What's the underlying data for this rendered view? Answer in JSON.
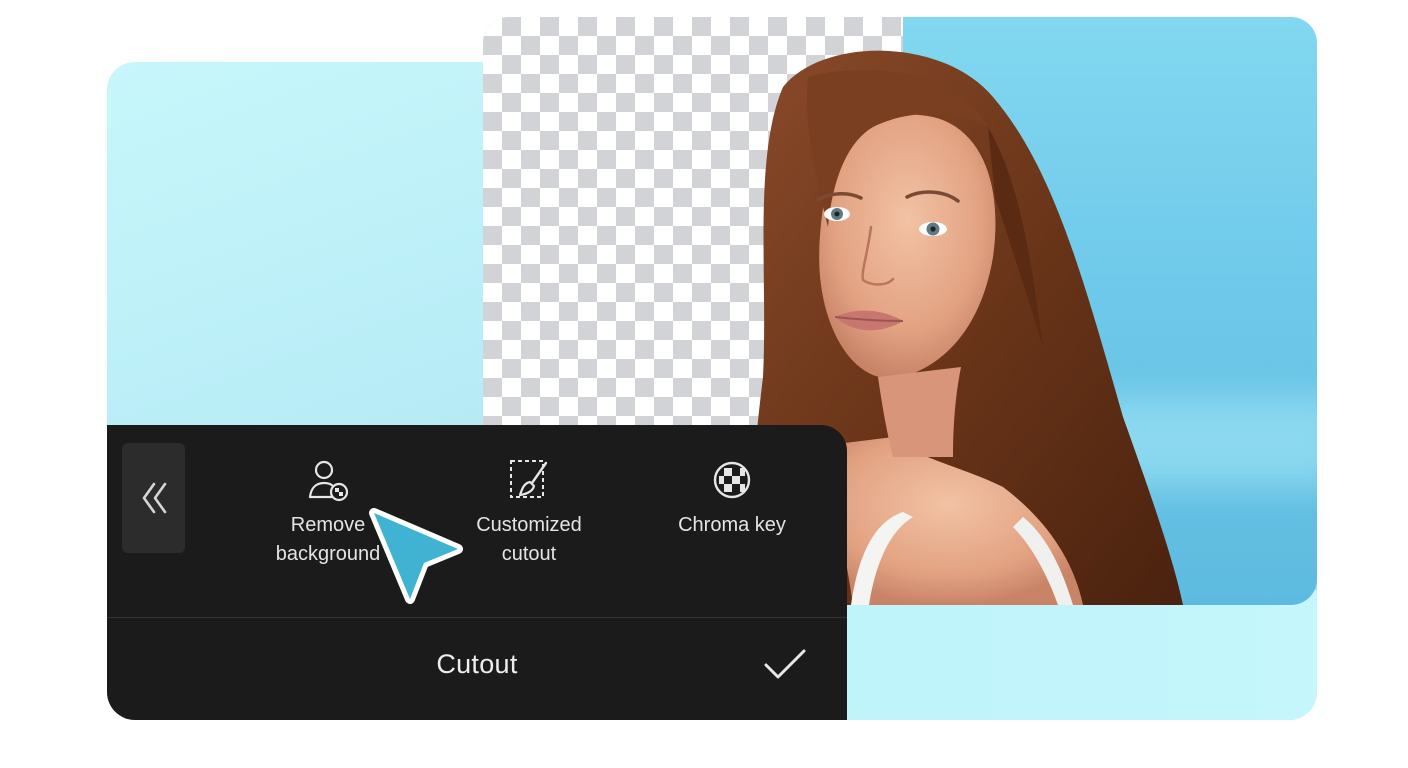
{
  "panel": {
    "collapse_icon": "double-chevron-left-icon",
    "tools": [
      {
        "label": "Remove\nbackground",
        "icon": "remove-background-icon"
      },
      {
        "label": "Customized\ncutout",
        "icon": "brush-selection-icon"
      },
      {
        "label": "Chroma key",
        "icon": "chroma-key-icon"
      }
    ],
    "title": "Cutout",
    "confirm_icon": "checkmark-icon"
  },
  "preview": {
    "transparency_icon": "checkerboard-transparency",
    "subject": "portrait-woman"
  },
  "pointer_icon": "cursor-arrow-icon",
  "colors": {
    "panel_bg": "#1b1b1b",
    "accent_cursor": "#3fb3d1",
    "backdrop_blue": "#6fc9ea",
    "backdrop_light": "#c7f7fb"
  }
}
